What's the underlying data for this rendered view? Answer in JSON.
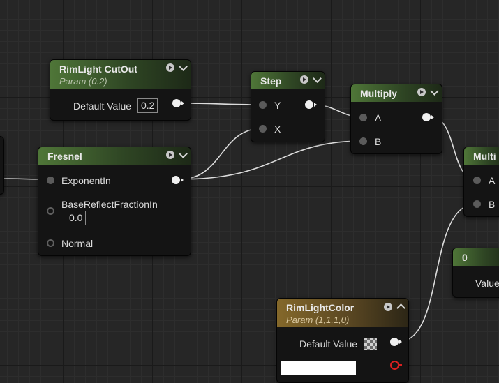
{
  "nodes": {
    "rimlight_cutout": {
      "title": "RimLight CutOut",
      "subtitle": "Param (0.2)",
      "default_label": "Default Value",
      "default_value": "0.2"
    },
    "step": {
      "title": "Step",
      "pins": {
        "y": "Y",
        "x": "X"
      }
    },
    "multiply": {
      "title": "Multiply",
      "pins": {
        "a": "A",
        "b": "B"
      }
    },
    "multiply2": {
      "title": "Multi",
      "pins": {
        "a": "A",
        "b": "B"
      }
    },
    "fresnel": {
      "title": "Fresnel",
      "pins": {
        "exponent": "ExponentIn",
        "base_reflect": "BaseReflectFractionIn",
        "normal": "Normal"
      },
      "base_reflect_value": "0.0"
    },
    "const0": {
      "title": "0",
      "value_label": "Value"
    },
    "rimlight_color": {
      "title": "RimLightColor",
      "subtitle": "Param (1,1,1,0)",
      "default_label": "Default Value"
    }
  },
  "colors": {
    "background": "#262626",
    "scalar_header": "#4f7638",
    "vector_header": "#84682a",
    "wire": "#e0e0e0"
  }
}
